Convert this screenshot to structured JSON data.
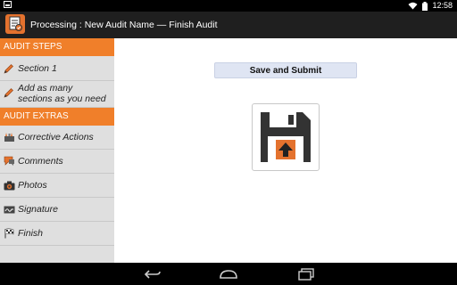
{
  "status_bar": {
    "time": "12:58",
    "icons": [
      "notification-icon",
      "wifi-icon",
      "battery-icon"
    ]
  },
  "action_bar": {
    "title": "Processing : New Audit Name — Finish Audit",
    "logo_icon": "audit-app-logo"
  },
  "sidebar": {
    "audit_steps_header": "AUDIT STEPS",
    "steps": [
      {
        "label": "Section 1",
        "icon": "pencil-icon"
      },
      {
        "label": "Add as many sections as you need",
        "icon": "pencil-icon"
      }
    ],
    "audit_extras_header": "AUDIT EXTRAS",
    "extras": [
      {
        "label": "Corrective Actions",
        "icon": "tools-icon"
      },
      {
        "label": "Comments",
        "icon": "comment-icon"
      },
      {
        "label": "Photos",
        "icon": "camera-icon"
      },
      {
        "label": "Signature",
        "icon": "signature-icon"
      },
      {
        "label": "Finish",
        "icon": "checkered-flag-icon"
      }
    ]
  },
  "main": {
    "submit_label": "Save and Submit",
    "save_icon": "save-upload-icon"
  },
  "colors": {
    "accent": "#f07f2a",
    "actionbar": "#1f1f1f",
    "sidebar_bg": "#dfdfdf",
    "button_bg": "#dfe5f3"
  }
}
